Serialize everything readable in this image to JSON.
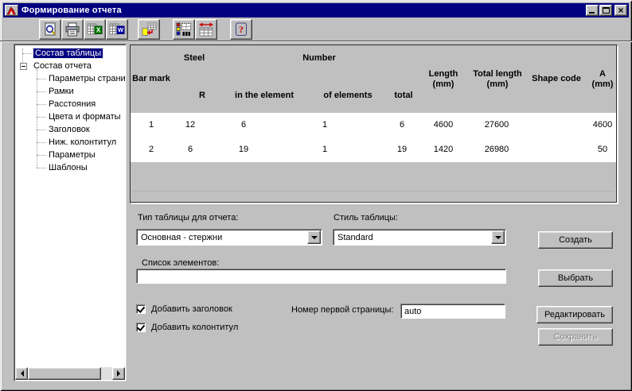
{
  "window": {
    "title": "Формирование отчета",
    "icon": "app-logo-icon",
    "controls": {
      "minimize": "minimize-icon",
      "maximize": "maximize-icon",
      "close": "close-icon",
      "close_glyph": "×"
    }
  },
  "toolbar": {
    "buttons": [
      {
        "icon": "print-preview-icon"
      },
      {
        "icon": "print-icon"
      },
      {
        "icon": "export-excel-icon",
        "glyph": "X"
      },
      {
        "icon": "export-word-icon",
        "glyph": "W"
      },
      {
        "icon": "insert-report-table-icon"
      },
      {
        "icon": "colors-formats-icon"
      },
      {
        "icon": "column-width-icon"
      },
      {
        "icon": "help-icon",
        "glyph": "?"
      }
    ]
  },
  "tree": {
    "items": [
      {
        "label": "Состав таблицы",
        "selected": true
      },
      {
        "label": "Состав отчета",
        "expanded": true
      },
      {
        "label": "Параметры страниц"
      },
      {
        "label": "Рамки"
      },
      {
        "label": "Расстояния"
      },
      {
        "label": "Цвета и форматы"
      },
      {
        "label": "Заголовок"
      },
      {
        "label": "Ниж. колонтитул"
      },
      {
        "label": "Параметры"
      },
      {
        "label": "Шаблоны"
      }
    ]
  },
  "table": {
    "header": {
      "bar_mark": "Bar mark",
      "steel": "Steel",
      "r": "R",
      "number": "Number",
      "in_the_element": "in the element",
      "of_elements": "of elements",
      "total": "total",
      "length": "Length\n(mm)",
      "total_length": "Total length\n(mm)",
      "shape_code": "Shape code",
      "a": "A\n(mm)"
    },
    "rows": [
      [
        "1",
        "12",
        "6",
        "1",
        "6",
        "4600",
        "27600",
        "",
        "4600"
      ],
      [
        "2",
        "6",
        "19",
        "1",
        "19",
        "1420",
        "26980",
        "",
        "50"
      ]
    ]
  },
  "form": {
    "table_type_label": "Тип таблицы для отчета:",
    "table_type_value": "Основная - стержни",
    "style_label": "Стиль таблицы:",
    "style_value": "Standard",
    "elements_label": "Список элементов:",
    "elements_value": "",
    "add_header_label": "Добавить заголовок",
    "add_header_checked": true,
    "add_footer_label": "Добавить колонтитул",
    "add_footer_checked": true,
    "first_page_label": "Номер первой страницы:",
    "first_page_value": "auto",
    "buttons": {
      "create": "Создать",
      "select": "Выбрать",
      "edit": "Редактировать",
      "save": "Сохранить"
    }
  },
  "colors": {
    "titlebar": "#000080",
    "window_bg": "#c0c0c0",
    "selection": "#000080",
    "table_body": "#ffffff",
    "disabled_text": "#808080"
  }
}
